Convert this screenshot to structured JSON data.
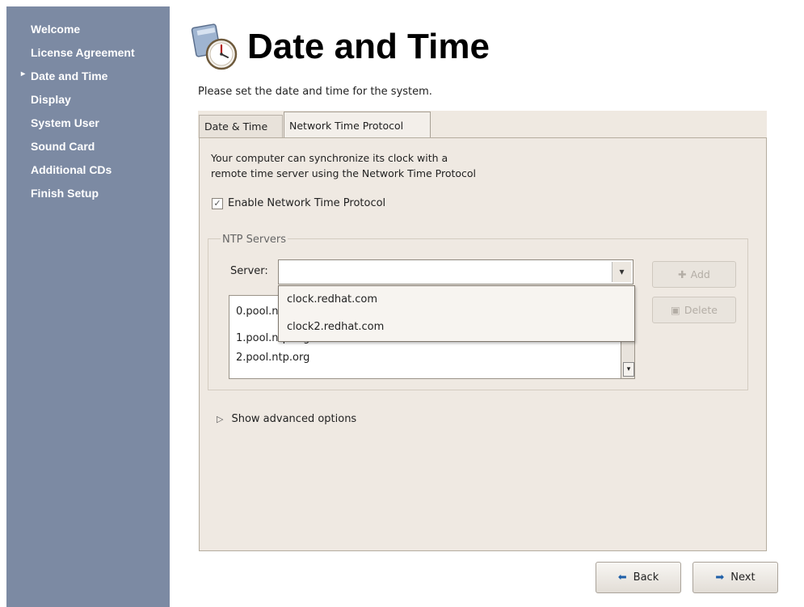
{
  "sidebar": {
    "items": [
      {
        "label": "Welcome",
        "current": false
      },
      {
        "label": "License Agreement",
        "current": false
      },
      {
        "label": "Date and Time",
        "current": true
      },
      {
        "label": "Display",
        "current": false
      },
      {
        "label": "System User",
        "current": false
      },
      {
        "label": "Sound Card",
        "current": false
      },
      {
        "label": "Additional CDs",
        "current": false
      },
      {
        "label": "Finish Setup",
        "current": false
      }
    ]
  },
  "header": {
    "title": "Date and Time",
    "subtitle": "Please set the date and time for the system."
  },
  "tabs": [
    {
      "label": "Date & Time",
      "active": false
    },
    {
      "label": "Network Time Protocol",
      "active": true
    }
  ],
  "ntp": {
    "info_line1": "Your computer can synchronize its clock with a",
    "info_line2": "remote time server using the Network Time Protocol",
    "enable_label": "Enable Network Time Protocol",
    "enable_checked": true,
    "servers_frame_label": "NTP Servers",
    "server_label": "Server:",
    "server_value": "",
    "add_label": "Add",
    "delete_label": "Delete",
    "server_list": [
      "0.pool.ntp.org",
      "1.pool.ntp.org",
      "2.pool.ntp.org"
    ],
    "dropdown_options": [
      "clock.redhat.com",
      "clock2.redhat.com"
    ],
    "advanced_label": "Show advanced options"
  },
  "footer": {
    "back_label": "Back",
    "next_label": "Next"
  },
  "colors": {
    "sidebar_bg": "#7c8aa3",
    "panel_bg": "#efe9e2",
    "accent_arrow": "#1e5fa8"
  }
}
